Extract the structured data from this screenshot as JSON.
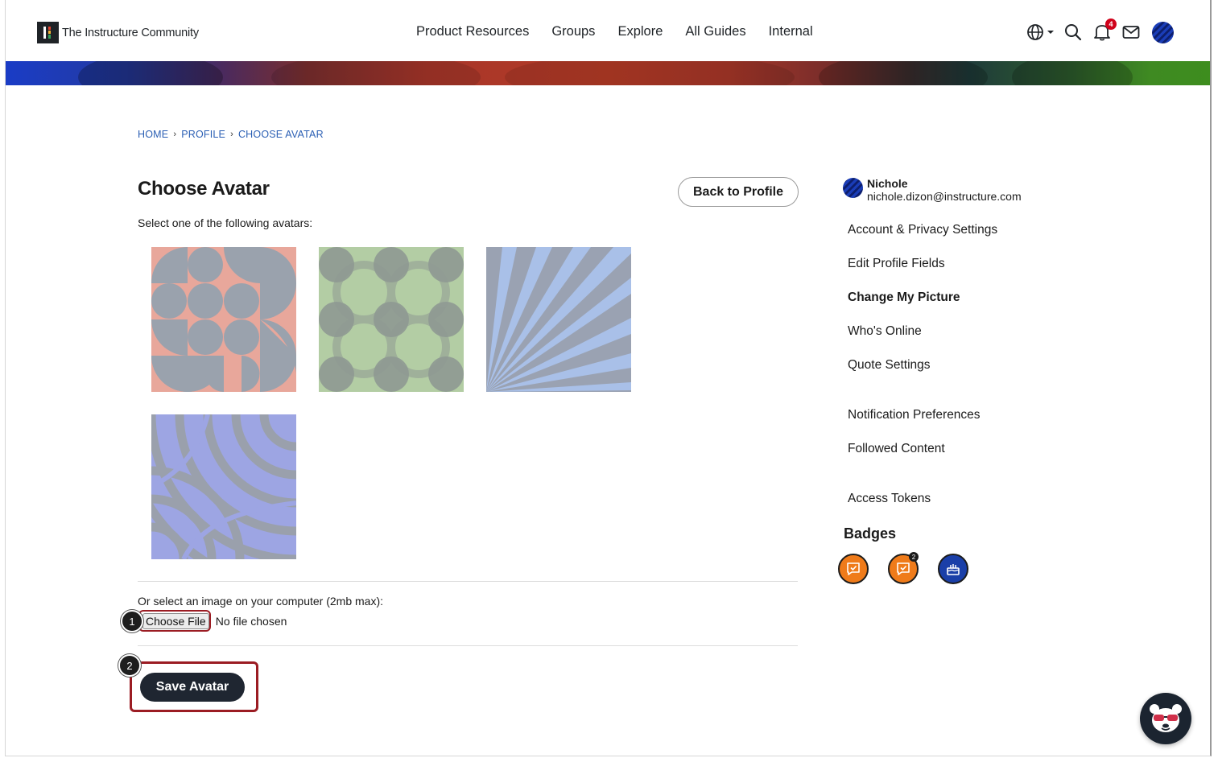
{
  "header": {
    "logo_text": "The Instructure Community",
    "nav": [
      "Product Resources",
      "Groups",
      "Explore",
      "All Guides",
      "Internal"
    ],
    "notification_count": "4"
  },
  "breadcrumb": [
    "HOME",
    "PROFILE",
    "CHOOSE AVATAR"
  ],
  "main": {
    "title": "Choose Avatar",
    "back_button": "Back to Profile",
    "instruction": "Select one of the following avatars:",
    "file_label": "Or select an image on your computer (2mb max):",
    "choose_file_button": "Choose File",
    "file_status": "No file chosen",
    "save_button": "Save Avatar"
  },
  "callouts": [
    "1",
    "2"
  ],
  "sidebar": {
    "user_name": "Nichole",
    "user_email": "nichole.dizon@instructure.com",
    "links": [
      "Account & Privacy Settings",
      "Edit Profile Fields",
      "Change My Picture",
      "Who's Online",
      "Quote Settings",
      "Notification Preferences",
      "Followed Content",
      "Access Tokens"
    ],
    "active_link": "Change My Picture",
    "badges_title": "Badges",
    "badge_sub_count": "2"
  },
  "colors": {
    "accent_dark": "#1f2631",
    "callout_red": "#9b1c23",
    "link_blue": "#2b5fb4",
    "badge_orange": "#ef7b1a",
    "badge_blue": "#1a3fa8"
  }
}
